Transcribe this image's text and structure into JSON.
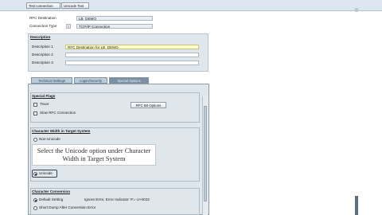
{
  "toolbar": {
    "test_connection": "Test connection",
    "unicode_test": "Unicode Test"
  },
  "header": {
    "rfc_destination_label": "RFC Destination",
    "rfc_destination_value": "LB_DEMO",
    "connection_type_label": "Connection Type",
    "connection_type_code": "T",
    "connection_type_value": "TCP/IP Connection"
  },
  "description": {
    "title": "Description",
    "desc1_label": "Description 1",
    "desc1_value": "RFC Destination for LB_DEMO",
    "desc2_label": "Description 2",
    "desc2_value": "",
    "desc3_label": "Description 3",
    "desc3_value": ""
  },
  "tabs": [
    {
      "label": "Technical Settings",
      "active": false
    },
    {
      "label": "Logon/Security",
      "active": false
    },
    {
      "label": "Special Options",
      "active": true
    }
  ],
  "special_flags": {
    "title": "Special Flags",
    "trace_label": "Trace",
    "slow_rfc_label": "Slow RFC Connection",
    "rfc_bit_options_button": "RFC Bit Options"
  },
  "unicode_width": {
    "title": "Character Width in Target System",
    "non_unicode_label": "Non-Unicode",
    "unicode_label": "Unicode",
    "selected": "Unicode"
  },
  "tooltip": {
    "line1": "Select the Unicode option under Character",
    "line2": "Width in Target System"
  },
  "character_conversion": {
    "title": "Character Conversion",
    "default_setting_label": "Default Setting",
    "default_setting_note": "Ignore Error, Error Indicator '#'= U+0023",
    "abort_label": "Short Dump After Conversion Error"
  },
  "colors": {
    "toolbar_bg": "#dde6ee",
    "panel_bg": "#dfe6ec",
    "active_tab": "#7b90a3",
    "input_highlight": "#ffffcc"
  }
}
